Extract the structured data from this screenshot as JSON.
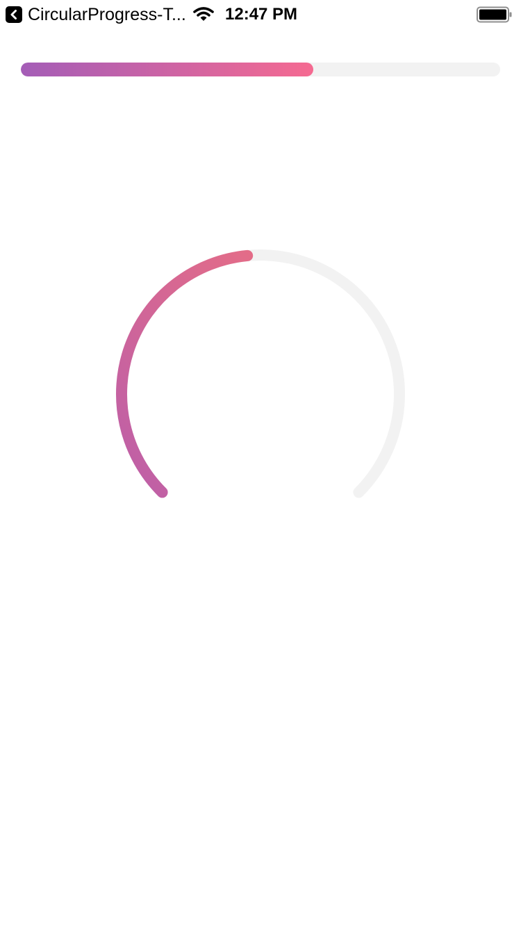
{
  "status_bar": {
    "back_label": "CircularProgress-T...",
    "time": "12:47 PM"
  },
  "linear_progress": {
    "value": 0.61,
    "gradient_start": "#A45DB7",
    "gradient_end": "#F56A91",
    "track_color": "#F2F2F2"
  },
  "circular_progress": {
    "value": 0.48,
    "gradient_start": "#BD5FA8",
    "gradient_end": "#F4727A",
    "track_color": "#F2F2F2"
  },
  "icons": {
    "back": "chevron-left-icon",
    "wifi": "wifi-icon",
    "battery": "battery-icon"
  }
}
